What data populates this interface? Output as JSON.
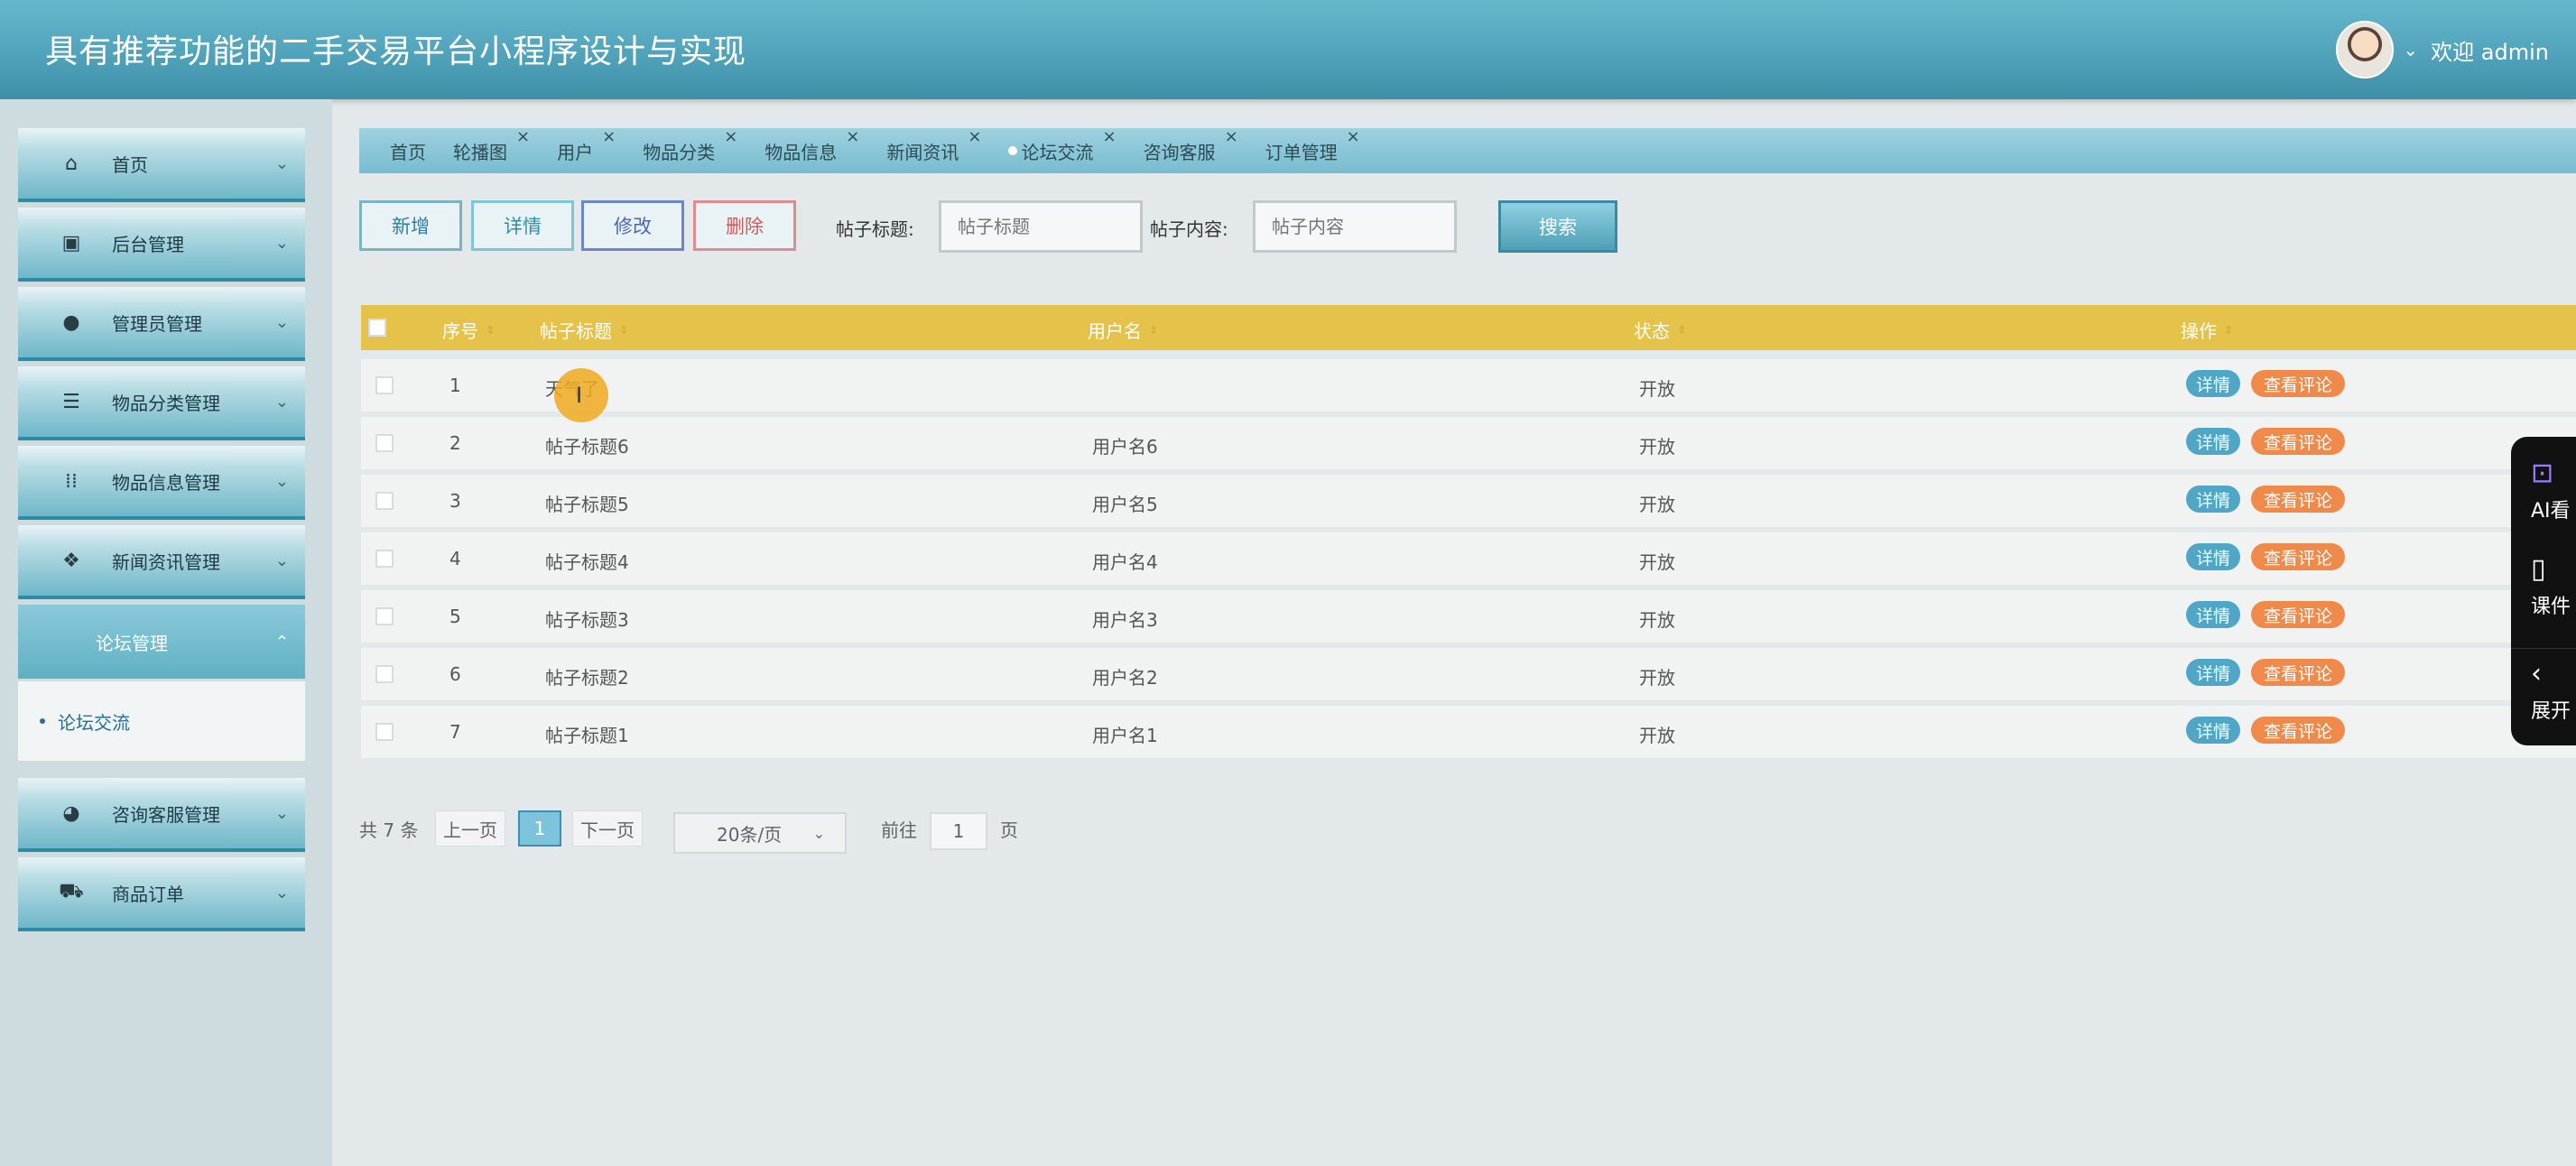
{
  "header": {
    "title": "具有推荐功能的二手交易平台小程序设计与实现",
    "welcome": "欢迎 admin"
  },
  "sidebar": {
    "items": [
      {
        "label": "首页",
        "icon": "home-icon"
      },
      {
        "label": "后台管理",
        "icon": "chip-icon"
      },
      {
        "label": "管理员管理",
        "icon": "user-circle-icon"
      },
      {
        "label": "物品分类管理",
        "icon": "server-icon"
      },
      {
        "label": "物品信息管理",
        "icon": "grid-icon"
      },
      {
        "label": "新闻资讯管理",
        "icon": "apps-icon"
      },
      {
        "label": "论坛管理",
        "icon": ""
      },
      {
        "label": "咨询客服管理",
        "icon": "gauge-icon"
      },
      {
        "label": "商品订单",
        "icon": "car-icon"
      }
    ],
    "submenu": {
      "label": "论坛交流"
    }
  },
  "tabs": [
    {
      "label": "首页",
      "closable": false
    },
    {
      "label": "轮播图",
      "closable": true
    },
    {
      "label": "用户",
      "closable": true
    },
    {
      "label": "物品分类",
      "closable": true
    },
    {
      "label": "物品信息",
      "closable": true
    },
    {
      "label": "新闻资讯",
      "closable": true
    },
    {
      "label": "论坛交流",
      "closable": true,
      "active": true
    },
    {
      "label": "咨询客服",
      "closable": true
    },
    {
      "label": "订单管理",
      "closable": true
    }
  ],
  "toolbar": {
    "add": "新增",
    "detail": "详情",
    "edit": "修改",
    "delete": "删除",
    "title_label": "帖子标题:",
    "title_placeholder": "帖子标题",
    "content_label": "帖子内容:",
    "content_placeholder": "帖子内容",
    "search": "搜索"
  },
  "table": {
    "columns": [
      "序号",
      "帖子标题",
      "用户名",
      "状态",
      "操作"
    ],
    "rows": [
      {
        "no": "1",
        "title": "天气了",
        "user": "",
        "status": "开放"
      },
      {
        "no": "2",
        "title": "帖子标题6",
        "user": "用户名6",
        "status": "开放"
      },
      {
        "no": "3",
        "title": "帖子标题5",
        "user": "用户名5",
        "status": "开放"
      },
      {
        "no": "4",
        "title": "帖子标题4",
        "user": "用户名4",
        "status": "开放"
      },
      {
        "no": "5",
        "title": "帖子标题3",
        "user": "用户名3",
        "status": "开放"
      },
      {
        "no": "6",
        "title": "帖子标题2",
        "user": "用户名2",
        "status": "开放"
      },
      {
        "no": "7",
        "title": "帖子标题1",
        "user": "用户名1",
        "status": "开放"
      }
    ],
    "action_detail": "详情",
    "action_comments": "查看评论"
  },
  "pagination": {
    "total": "共 7 条",
    "prev": "上一页",
    "current": "1",
    "next": "下一页",
    "page_size": "20条/页",
    "goto_label": "前往",
    "goto_value": "1",
    "page_suffix": "页"
  },
  "float_panel": {
    "items": [
      "AI看",
      "课件",
      "展开"
    ]
  },
  "colors": {
    "header": "#4ea1b8",
    "table_header": "#e5c24a",
    "tag_detail": "#4fa6c6",
    "tag_comment": "#f08a4b"
  }
}
